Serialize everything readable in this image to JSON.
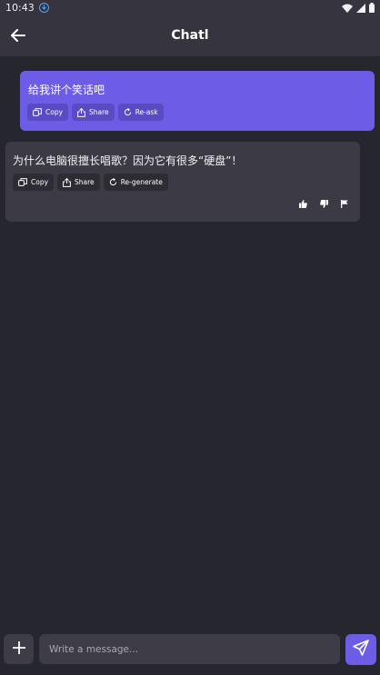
{
  "status_bar": {
    "time": "10:43"
  },
  "app_bar": {
    "title": "Chatl"
  },
  "conversation": {
    "user_message": {
      "text": "给我讲个笑话吧",
      "actions": {
        "copy": "Copy",
        "share": "Share",
        "reask": "Re-ask"
      }
    },
    "ai_message": {
      "text": "为什么电脑很擅长唱歌？因为它有很多“硬盘”！",
      "actions": {
        "copy": "Copy",
        "share": "Share",
        "regenerate": "Re-generate"
      }
    }
  },
  "composer": {
    "placeholder": "Write a message..."
  },
  "colors": {
    "background": "#26262f",
    "bar": "#35343f",
    "accent": "#6d5ce6",
    "card": "#3b3a45"
  },
  "icons": [
    "download-status-icon",
    "wifi-icon",
    "signal-icon",
    "battery-icon",
    "back-arrow-icon",
    "copy-icon",
    "share-icon",
    "refresh-icon",
    "thumbs-up-icon",
    "thumbs-down-icon",
    "flag-icon",
    "plus-icon",
    "send-icon"
  ]
}
